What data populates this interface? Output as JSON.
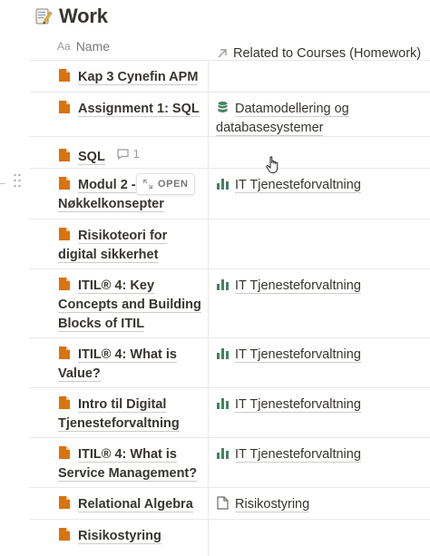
{
  "page": {
    "title": "Work",
    "emoji": "memo-icon"
  },
  "table": {
    "columns": [
      {
        "label": "Name",
        "icon": "Aa"
      },
      {
        "label": "Related to Courses (Homework)",
        "icon": "relation-arrow-icon"
      }
    ],
    "open_label": "OPEN",
    "rows": [
      {
        "name": "Kap 3 Cynefin APM",
        "related": "",
        "related_icon": ""
      },
      {
        "name": "Assignment 1: SQL",
        "related": "Datamodellering og databasesystemer",
        "related_icon": "database"
      },
      {
        "name": "SQL",
        "comments": "1",
        "related": "",
        "related_icon": ""
      },
      {
        "name": "Modul 2 - Nøkkelkonsepter",
        "related": "IT Tjenesteforvaltning",
        "related_icon": "chart"
      },
      {
        "name": "Risikoteori for digital sikkerhet",
        "related": "",
        "related_icon": ""
      },
      {
        "name": "ITIL® 4: Key Concepts and Building Blocks of ITIL",
        "related": "IT Tjenesteforvaltning",
        "related_icon": "chart"
      },
      {
        "name": "ITIL® 4: What is Value?",
        "related": "IT Tjenesteforvaltning",
        "related_icon": "chart"
      },
      {
        "name": "Intro til Digital Tjenesteforvaltning",
        "related": "IT Tjenesteforvaltning",
        "related_icon": "chart"
      },
      {
        "name": "ITIL® 4: What is Service Management?",
        "related": "IT Tjenesteforvaltning",
        "related_icon": "chart"
      },
      {
        "name": "Relational Algebra",
        "related": "Risikostyring",
        "related_icon": "page"
      },
      {
        "name": "Risikostyring",
        "related": "",
        "related_icon": ""
      }
    ]
  },
  "colors": {
    "doc_icon": "#d9730d",
    "chart_icon": "#448361",
    "database_icon": "#448361",
    "border": "#e9e9e7",
    "text": "#37352f",
    "muted": "#787774"
  }
}
